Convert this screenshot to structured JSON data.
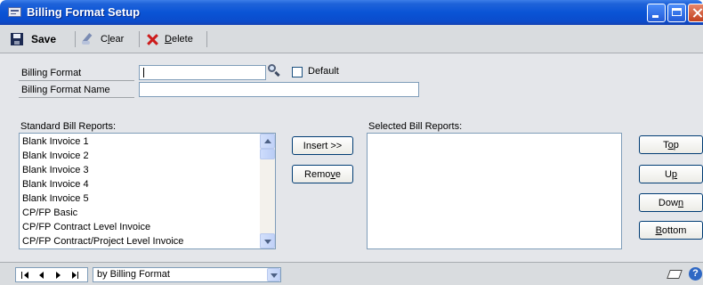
{
  "window": {
    "title": "Billing Format Setup"
  },
  "toolbar": {
    "save": {
      "label": "Save"
    },
    "clear": {
      "pre": "C",
      "ul": "l",
      "post": "ear"
    },
    "delete": {
      "pre": "",
      "ul": "D",
      "post": "elete"
    }
  },
  "form": {
    "billing_format_label": "Billing Format",
    "billing_format_value": "",
    "default_label": "Default",
    "default_checked": false,
    "billing_format_name_label": "Billing Format Name",
    "billing_format_name_value": ""
  },
  "standard_reports": {
    "label": "Standard Bill Reports:",
    "items": [
      "Blank Invoice 1",
      "Blank Invoice 2",
      "Blank Invoice 3",
      "Blank Invoice 4",
      "Blank Invoice 5",
      "CP/FP Basic",
      "CP/FP Contract Level Invoice",
      "CP/FP Contract/Project Level Invoice"
    ]
  },
  "selected_reports": {
    "label": "Selected Bill Reports:",
    "items": []
  },
  "buttons": {
    "insert": "Insert >>",
    "remove": {
      "pre": "Remo",
      "ul": "v",
      "post": "e"
    },
    "top": {
      "pre": "T",
      "ul": "o",
      "post": "p"
    },
    "up": {
      "pre": "U",
      "ul": "p",
      "post": ""
    },
    "down": {
      "pre": "Dow",
      "ul": "n",
      "post": ""
    },
    "bottom": {
      "pre": "",
      "ul": "B",
      "post": "ottom"
    }
  },
  "statusbar": {
    "sort_by": "by Billing Format"
  },
  "icons": {
    "app": "window-icon",
    "save": "floppy-disk-icon",
    "clear": "eraser-icon",
    "delete": "red-x-icon",
    "lookup": "magnifier-icon",
    "note": "note-icon",
    "help": "help-icon"
  }
}
